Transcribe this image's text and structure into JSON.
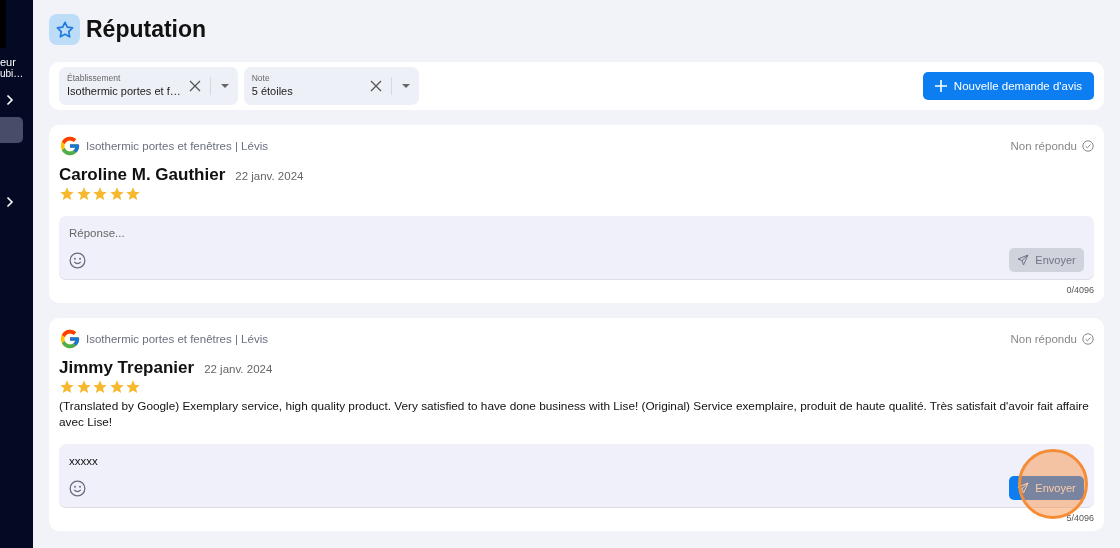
{
  "sidebar": {
    "texts": [
      "eur",
      "ubi…"
    ],
    "items": [
      {
        "kind": "chevron",
        "selected": false
      },
      {
        "kind": "block",
        "selected": true
      },
      {
        "kind": "chevron",
        "selected": false
      }
    ]
  },
  "page": {
    "title": "Réputation"
  },
  "filters": [
    {
      "label": "Établissement",
      "value": "Isothermic portes et f…"
    },
    {
      "label": "Note",
      "value": "5 étoiles"
    }
  ],
  "new_button": {
    "label": "Nouvelle demande d'avis"
  },
  "reviews": [
    {
      "source": "Isothermic portes et fenêtres | Lévis",
      "status": "Non répondu",
      "author": "Caroline M. Gauthier",
      "date": "22 janv. 2024",
      "stars": 5,
      "reply_placeholder": "Réponse...",
      "send": {
        "label": "Envoyer",
        "disabled": true,
        "highlighted": false
      },
      "count": "0/4096"
    },
    {
      "source": "Isothermic portes et fenêtres | Lévis",
      "status": "Non répondu",
      "author": "Jimmy Trepanier",
      "date": "22 janv. 2024",
      "stars": 5,
      "text": "(Translated by Google) Exemplary service, high quality product. Very satisfied to have done business with Lise! (Original) Service exemplaire, produit de haute qualité. Très satisfait d'avoir fait affaire avec Lise!",
      "reply_value": "xxxxx",
      "send": {
        "label": "Envoyer",
        "disabled": false,
        "highlighted": true
      },
      "count": "5/4096"
    }
  ]
}
